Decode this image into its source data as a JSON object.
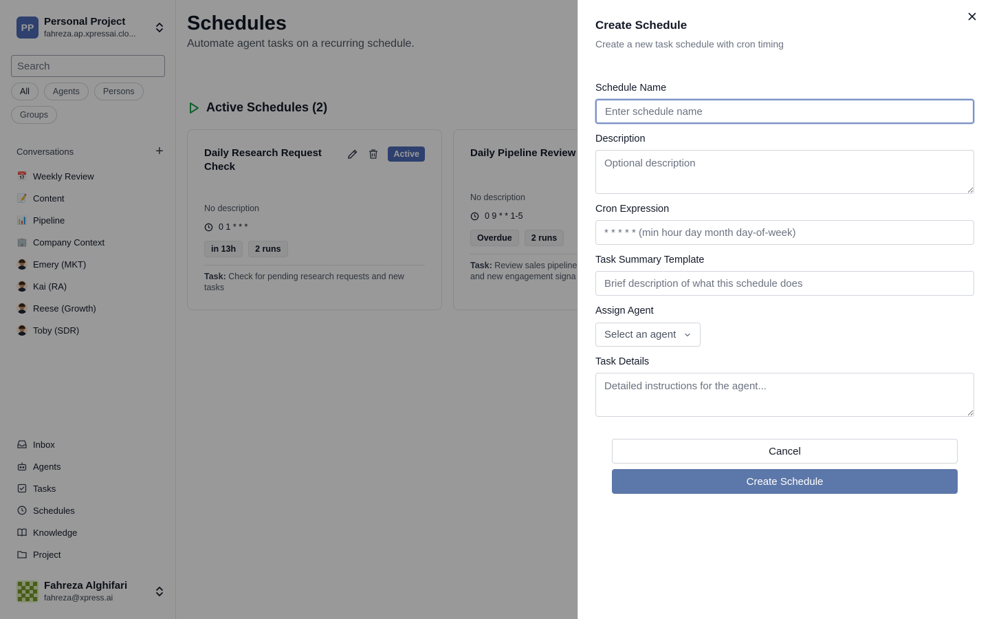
{
  "workspace": {
    "initials": "PP",
    "name": "Personal Project",
    "account": "fahreza.ap.xpressai.clo...",
    "switch_icon": "chevrons-up-down-icon"
  },
  "search": {
    "placeholder": "Search"
  },
  "filters": [
    {
      "label": "All",
      "active": true
    },
    {
      "label": "Agents",
      "active": false
    },
    {
      "label": "Persons",
      "active": false
    },
    {
      "label": "Groups",
      "active": false
    }
  ],
  "conversations": {
    "heading": "Conversations",
    "add_icon": "+",
    "items": [
      {
        "icon": "📅",
        "label": "Weekly Review"
      },
      {
        "icon": "📝",
        "label": "Content"
      },
      {
        "icon": "📊",
        "label": "Pipeline"
      },
      {
        "icon": "🏢",
        "label": "Company Context"
      },
      {
        "icon": "person",
        "label": "Emery (MKT)"
      },
      {
        "icon": "person",
        "label": "Kai (RA)"
      },
      {
        "icon": "person",
        "label": "Reese (Growth)"
      },
      {
        "icon": "person",
        "label": "Toby (SDR)"
      }
    ]
  },
  "nav": [
    {
      "icon": "inbox-icon",
      "label": "Inbox"
    },
    {
      "icon": "bot-icon",
      "label": "Agents"
    },
    {
      "icon": "check-square-icon",
      "label": "Tasks"
    },
    {
      "icon": "clock-icon",
      "label": "Schedules"
    },
    {
      "icon": "book-icon",
      "label": "Knowledge"
    },
    {
      "icon": "folder-icon",
      "label": "Project"
    }
  ],
  "user": {
    "name": "Fahreza Alghifari",
    "email": "fahreza@xpress.ai"
  },
  "page": {
    "title": "Schedules",
    "subtitle": "Automate agent tasks on a recurring schedule.",
    "section_title": "Active Schedules (2)"
  },
  "cards": [
    {
      "title": "Daily Research Request Check",
      "status": "Active",
      "description": "No description",
      "cron": "0 1 * * *",
      "tags": [
        "in 13h",
        "2 runs"
      ],
      "task_label": "Task:",
      "task": "Check for pending research requests and new tasks"
    },
    {
      "title": "Daily Pipeline Review",
      "description": "No description",
      "cron": "0 9 * * 1-5",
      "tags": [
        "Overdue",
        "2 runs"
      ],
      "task_label": "Task:",
      "task": "Review sales pipeline and new engagement signa"
    }
  ],
  "sheet": {
    "title": "Create Schedule",
    "subtitle": "Create a new task schedule with cron timing",
    "fields": {
      "name": {
        "label": "Schedule Name",
        "placeholder": "Enter schedule name"
      },
      "description": {
        "label": "Description",
        "placeholder": "Optional description"
      },
      "cron": {
        "label": "Cron Expression",
        "placeholder": "* * * * * (min hour day month day-of-week)"
      },
      "summary": {
        "label": "Task Summary Template",
        "placeholder": "Brief description of what this schedule does"
      },
      "agent": {
        "label": "Assign Agent",
        "placeholder": "Select an agent"
      },
      "details": {
        "label": "Task Details",
        "placeholder": "Detailed instructions for the agent..."
      }
    },
    "cancel_label": "Cancel",
    "submit_label": "Create Schedule"
  },
  "colors": {
    "accent": "#4b6cb7",
    "submit": "#5c77a9",
    "overlay": "rgba(0,0,0,0.4)",
    "play": "#16a34a"
  }
}
